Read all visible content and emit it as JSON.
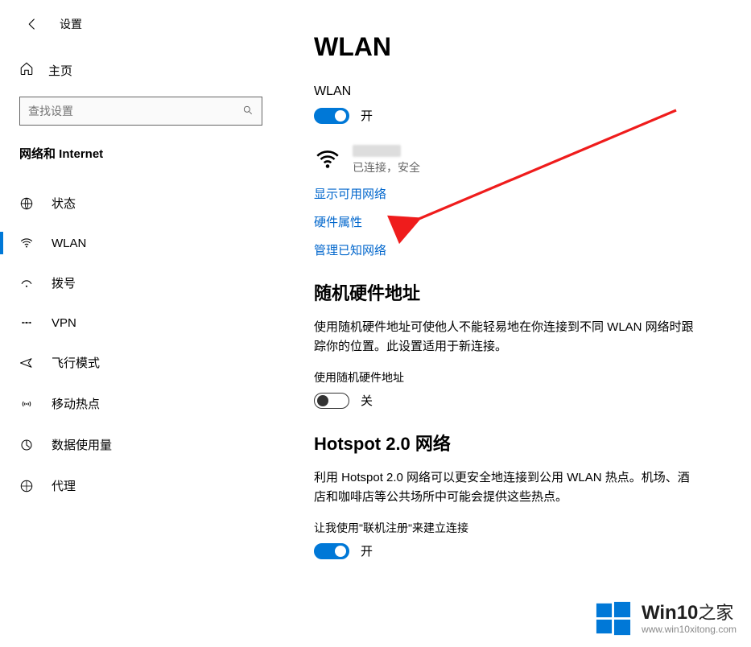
{
  "app": {
    "title": "设置"
  },
  "sidebar": {
    "home": "主页",
    "search_placeholder": "查找设置",
    "category": "网络和 Internet",
    "items": [
      {
        "label": "状态"
      },
      {
        "label": "WLAN"
      },
      {
        "label": "拨号"
      },
      {
        "label": "VPN"
      },
      {
        "label": "飞行模式"
      },
      {
        "label": "移动热点"
      },
      {
        "label": "数据使用量"
      },
      {
        "label": "代理"
      }
    ]
  },
  "wlan": {
    "page_title": "WLAN",
    "toggle_label": "WLAN",
    "toggle_state": "开",
    "connected_status": "已连接，安全",
    "links": {
      "show_networks": "显示可用网络",
      "hw_props": "硬件属性",
      "manage_known": "管理已知网络"
    }
  },
  "random_mac": {
    "title": "随机硬件地址",
    "desc": "使用随机硬件地址可使他人不能轻易地在你连接到不同 WLAN 网络时跟踪你的位置。此设置适用于新连接。",
    "sublabel": "使用随机硬件地址",
    "toggle_state": "关"
  },
  "hotspot2": {
    "title": "Hotspot 2.0 网络",
    "desc": "利用 Hotspot 2.0 网络可以更安全地连接到公用 WLAN 热点。机场、酒店和咖啡店等公共场所中可能会提供这些热点。",
    "sublabel": "让我使用\"联机注册\"来建立连接",
    "toggle_state": "开"
  },
  "watermark": {
    "brand": "Win10",
    "suffix": "之家",
    "url": "www.win10xitong.com"
  }
}
